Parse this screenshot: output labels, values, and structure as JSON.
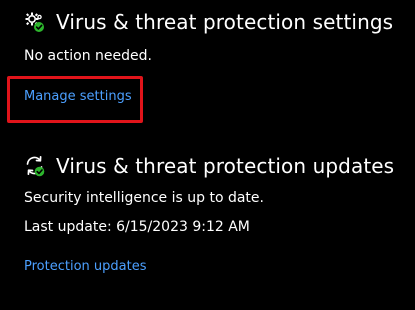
{
  "settings_section": {
    "title": "Virus & threat protection settings",
    "status": "No action needed.",
    "link_label": "Manage settings",
    "icon": "gear-check-icon"
  },
  "updates_section": {
    "title": "Virus & threat protection updates",
    "status": "Security intelligence is up to date.",
    "last_update": "Last update: 6/15/2023 9:12 AM",
    "link_label": "Protection updates",
    "icon": "refresh-check-icon"
  },
  "colors": {
    "background": "#000000",
    "text": "#ffffff",
    "link": "#4ca0ff",
    "highlight": "#e0141a",
    "ok_badge": "#2db52d"
  }
}
